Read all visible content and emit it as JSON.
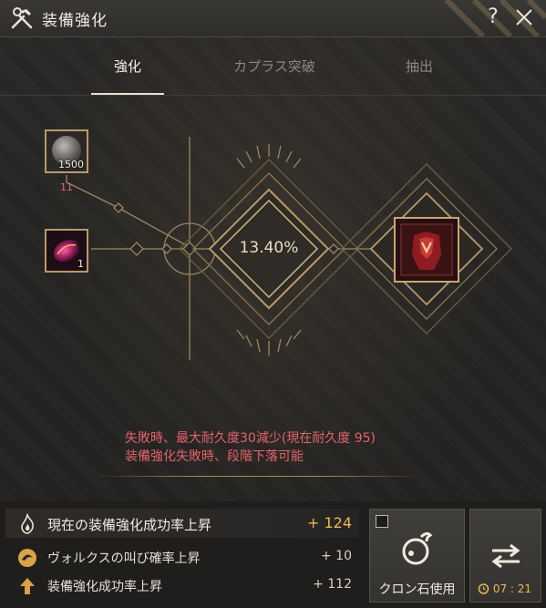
{
  "window": {
    "title": "装備強化",
    "help_label": "?"
  },
  "tabs": [
    {
      "label": "強化",
      "active": true
    },
    {
      "label": "カプラス突破",
      "active": false
    },
    {
      "label": "抽出",
      "active": false
    }
  ],
  "materials": [
    {
      "name": "black-stone-icon",
      "quantity": "1500",
      "required": "11"
    },
    {
      "name": "caphras-stone-icon",
      "quantity": "1"
    }
  ],
  "enhance": {
    "success_rate": "13.40%",
    "result_item_icon": "armor-v-icon"
  },
  "warnings": {
    "line1": "失敗時、最大耐久度30減少(現在耐久度 95)",
    "line2": "装備強化失敗時、段階下落可能"
  },
  "stats": [
    {
      "icon": "flame-icon",
      "label": "現在の装備強化成功率上昇",
      "value": "+ 124"
    },
    {
      "icon": "vorkus-icon",
      "label": "ヴォルクスの叫び確率上昇",
      "value": "+ 10"
    },
    {
      "icon": "arrow-up-icon",
      "label": "装備強化成功率上昇",
      "value": "+ 112"
    }
  ],
  "clone_button": {
    "label": "クロン石使用",
    "checked": false
  },
  "swap_button": {
    "timer": "07 : 21"
  },
  "colors": {
    "accent_gold": "#e8b95a",
    "warning_red": "#e5626d",
    "frame_gold": "#b79a6c"
  }
}
